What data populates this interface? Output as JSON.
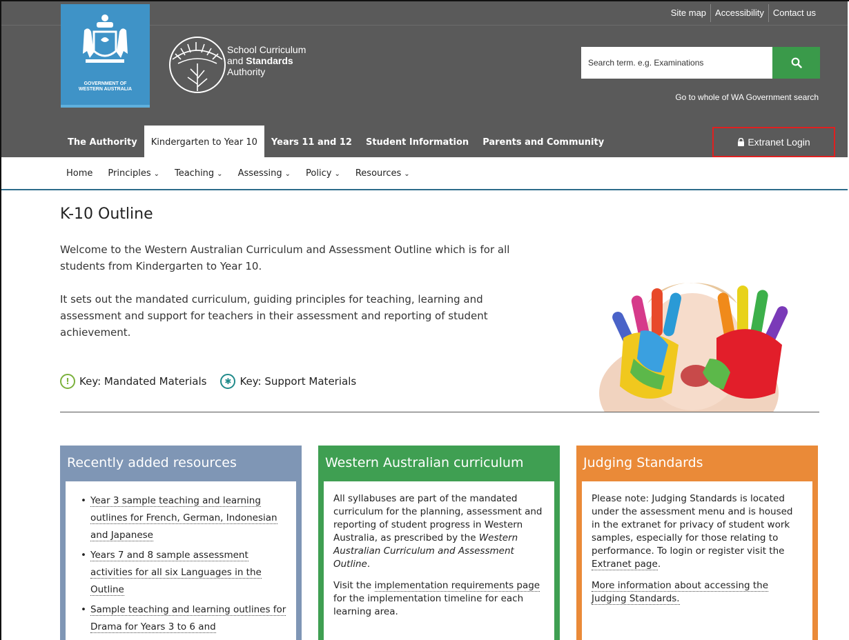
{
  "util_links": [
    "Site map",
    "Accessibility",
    "Contact us"
  ],
  "gov_label": [
    "GOVERNMENT OF",
    "WESTERN AUSTRALIA"
  ],
  "brand": {
    "line1": "School Curriculum",
    "line2_a": "and ",
    "line2_b": "Standards",
    "line3": "Authority"
  },
  "search": {
    "placeholder": "Search term. e.g. Examinations",
    "wa_link": "Go to whole of WA Government search"
  },
  "topnav": [
    "The Authority",
    "Kindergarten to Year 10",
    "Years 11 and 12",
    "Student Information",
    "Parents and Community"
  ],
  "extranet_label": "Extranet Login",
  "subnav": [
    "Home",
    "Principles",
    "Teaching",
    "Assessing",
    "Policy",
    "Resources"
  ],
  "page_title": "K-10 Outline",
  "intro": [
    "Welcome to the Western Australian Curriculum and Assessment Outline which is for all students from Kindergarten to Year 10.",
    "It sets out the mandated curriculum, guiding principles for teaching, learning and assessment and support for teachers in their assessment and reporting of student achievement."
  ],
  "keys": {
    "mandated": "Key: Mandated Materials",
    "support": "Key: Support Materials"
  },
  "cards": {
    "recent": {
      "title": "Recently added resources",
      "items": [
        "Year 3 sample teaching and learning outlines for French, German, Indonesian and Japanese",
        "Years 7 and 8 sample assessment activities for all six Languages in the Outline",
        "Sample teaching and learning outlines for Drama for Years 3 to 6 and"
      ]
    },
    "wa": {
      "title": "Western Australian curriculum",
      "p1_a": "All syllabuses are part of the mandated curriculum for the planning, assessment and reporting of student progress in Western Australia, as prescribed by the ",
      "p1_b": "Western Australian Curriculum and Assessment Outline",
      "p1_c": ".",
      "p2_a": "Visit the ",
      "p2_link": "implementation requirements page",
      "p2_b": " for the implementation timeline for each learning area."
    },
    "judging": {
      "title": "Judging Standards",
      "p1_a": "Please note: Judging Standards is located under the assessment menu and is housed in the extranet for privacy of student work samples, especially for those relating to performance. To login or register visit the ",
      "p1_link": "Extranet page",
      "p1_b": ".",
      "p2_link": "More information about accessing the Judging Standards."
    }
  },
  "colors": {
    "header": "#5a5a5a",
    "crest": "#3f93c7",
    "search_btn": "#3a9a4a",
    "card_blue": "#7f96b5",
    "card_green": "#3f9f52",
    "card_orange": "#ea8a38",
    "highlight": "#e02020"
  }
}
